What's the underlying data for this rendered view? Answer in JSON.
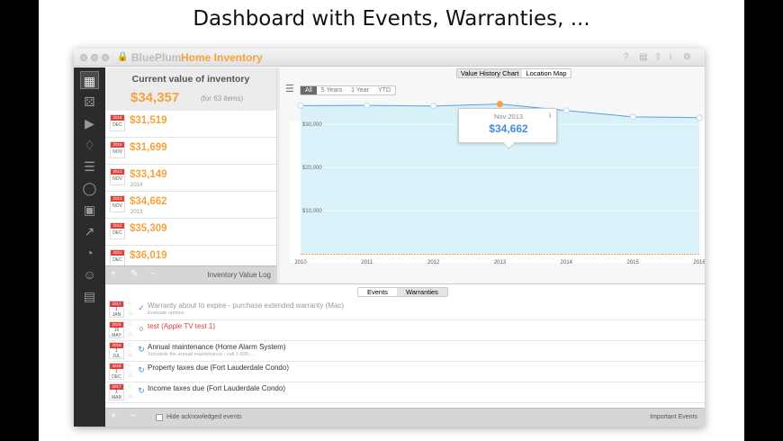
{
  "headline": "Dashboard with Events, Warranties, ...",
  "window": {
    "app_name": "BluePlum",
    "doc_name": "Home Inventory",
    "toolbar_icons": [
      "help-icon",
      "document-icon",
      "share-icon",
      "info-icon",
      "gear-icon"
    ]
  },
  "sidebar": {
    "items": [
      "dashboard-icon",
      "items-icon",
      "slideshow-icon",
      "tags-icon",
      "layers-icon",
      "location-icon",
      "photos-icon",
      "chart-icon",
      "pie-chart-icon",
      "contacts-icon",
      "report-icon"
    ],
    "active_index": 0
  },
  "value_panel": {
    "title": "Current value of inventory",
    "amount": "$34,357",
    "items_note": "(for 63 items)",
    "rows": [
      {
        "cal_year": "2016",
        "cal_month": "DEC",
        "amount": "$31,519",
        "year": ""
      },
      {
        "cal_year": "2015",
        "cal_month": "NOV",
        "amount": "$31,699",
        "year": ""
      },
      {
        "cal_year": "2014",
        "cal_month": "NOV",
        "amount": "$33,149",
        "year": "2014"
      },
      {
        "cal_year": "2013",
        "cal_month": "NOV",
        "amount": "$34,662",
        "year": "2013"
      },
      {
        "cal_year": "2012",
        "cal_month": "DEC",
        "amount": "$35,309",
        "year": ""
      },
      {
        "cal_year": "2011",
        "cal_month": "DEC",
        "amount": "$36,019",
        "year": ""
      }
    ],
    "footer_label": "Inventory Value Log"
  },
  "chart_panel": {
    "tabs": [
      "Value History Chart",
      "Location Map"
    ],
    "selected_tab": 0,
    "ranges": [
      "All",
      "5 Years",
      "1 Year",
      "YTD"
    ],
    "selected_range": 0,
    "tooltip": {
      "date": "Nov 2013",
      "value": "$34,662",
      "info": "i"
    }
  },
  "chart_data": {
    "type": "area",
    "x": [
      2010,
      2011,
      2012,
      2013,
      2014,
      2015,
      2016
    ],
    "values": [
      34300,
      34350,
      34200,
      34662,
      33149,
      31699,
      31519
    ],
    "xticks": [
      "2010",
      "2011",
      "2012",
      "2013",
      "2014",
      "2015",
      "2016"
    ],
    "yticks": [
      "$10,000",
      "$20,000",
      "$30,000"
    ],
    "ytick_values": [
      10000,
      20000,
      30000
    ],
    "ylim": [
      0,
      40000
    ],
    "highlight_index": 3,
    "colors": {
      "line": "#5a9fe0",
      "fill": "#d4f1fa",
      "marker_highlight": "#f5a33a",
      "baseline": "#f5a33a"
    }
  },
  "events_panel": {
    "tabs": [
      "Events",
      "Warranties"
    ],
    "selected_tab": 1,
    "rows": [
      {
        "cal_year": "2017",
        "cal_day": "1",
        "cal_month": "JAN",
        "title": "Warranty about to expire - purchase extended warranty (Mac)",
        "subtitle": "Evaluate options",
        "icon": "check-circle-icon",
        "title_color": "#999"
      },
      {
        "cal_year": "2016",
        "cal_day": "16",
        "cal_month": "MAY",
        "title": "test (Apple TV test 1)",
        "subtitle": "",
        "icon": "circle-icon",
        "title_color": "#e0403a"
      },
      {
        "cal_year": "2016",
        "cal_day": "1",
        "cal_month": "JUL",
        "title": "Annual maintenance (Home Alarm System)",
        "subtitle": "Schedule the annual maintenance - call 1-800-...",
        "icon": "repeat-icon",
        "title_color": "#333"
      },
      {
        "cal_year": "2016",
        "cal_day": "1",
        "cal_month": "DEC",
        "title": "Property taxes due (Fort Lauderdale Condo)",
        "subtitle": "",
        "icon": "repeat-icon",
        "title_color": "#333"
      },
      {
        "cal_year": "2017",
        "cal_day": "1",
        "cal_month": "MAR",
        "title": "Income taxes due (Fort Lauderdale Condo)",
        "subtitle": "",
        "icon": "repeat-icon",
        "title_color": "#333"
      }
    ],
    "footer": {
      "hide_label": "Hide acknowledged events",
      "important_label": "Important Events"
    }
  }
}
